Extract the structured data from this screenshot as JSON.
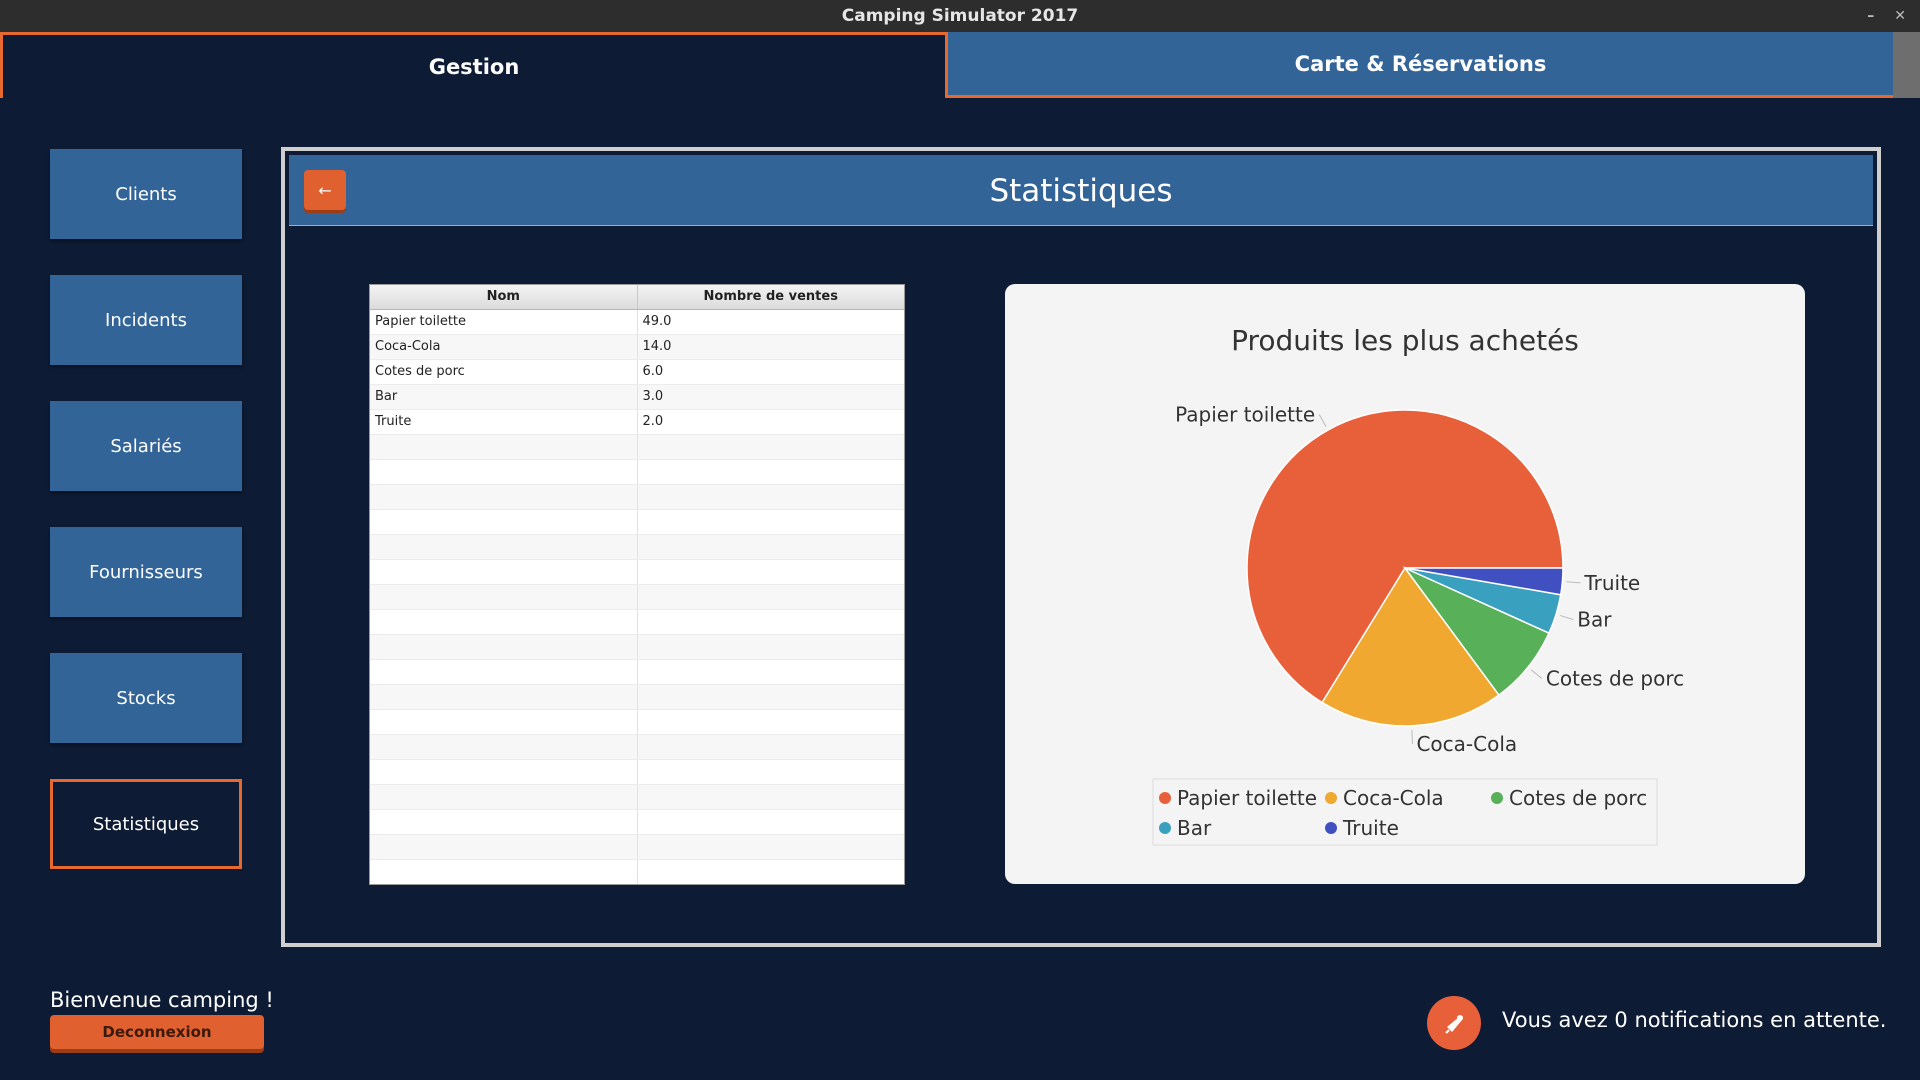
{
  "window": {
    "title": "Camping Simulator 2017",
    "min_glyph": "–",
    "close_glyph": "✕"
  },
  "tabs": [
    {
      "label": "Gestion",
      "active": true
    },
    {
      "label": "Carte & Réservations",
      "active": false
    }
  ],
  "sidebar": {
    "items": [
      {
        "label": "Clients"
      },
      {
        "label": "Incidents"
      },
      {
        "label": "Salariés"
      },
      {
        "label": "Fournisseurs"
      },
      {
        "label": "Stocks"
      },
      {
        "label": "Statistiques",
        "active": true
      }
    ]
  },
  "panel": {
    "title": "Statistiques",
    "back_glyph": "←"
  },
  "table": {
    "columns": [
      "Nom",
      "Nombre de ventes"
    ],
    "rows": [
      [
        "Papier toilette",
        "49.0"
      ],
      [
        "Coca-Cola",
        "14.0"
      ],
      [
        "Cotes de porc",
        "6.0"
      ],
      [
        "Bar",
        "3.0"
      ],
      [
        "Truite",
        "2.0"
      ]
    ]
  },
  "chart_data": {
    "type": "pie",
    "title": "Produits les plus achetés",
    "categories": [
      "Papier toilette",
      "Coca-Cola",
      "Cotes de porc",
      "Bar",
      "Truite"
    ],
    "values": [
      49,
      14,
      6,
      3,
      2
    ],
    "colors": [
      "#e8603a",
      "#f0a830",
      "#58b058",
      "#3aa0c0",
      "#4050c0"
    ],
    "legend_position": "bottom"
  },
  "footer": {
    "welcome": "Bienvenue camping !",
    "logout_label": "Deconnexion",
    "notification_text": "Vous avez 0 notifications en attente.",
    "notification_icon": "bell-icon"
  }
}
